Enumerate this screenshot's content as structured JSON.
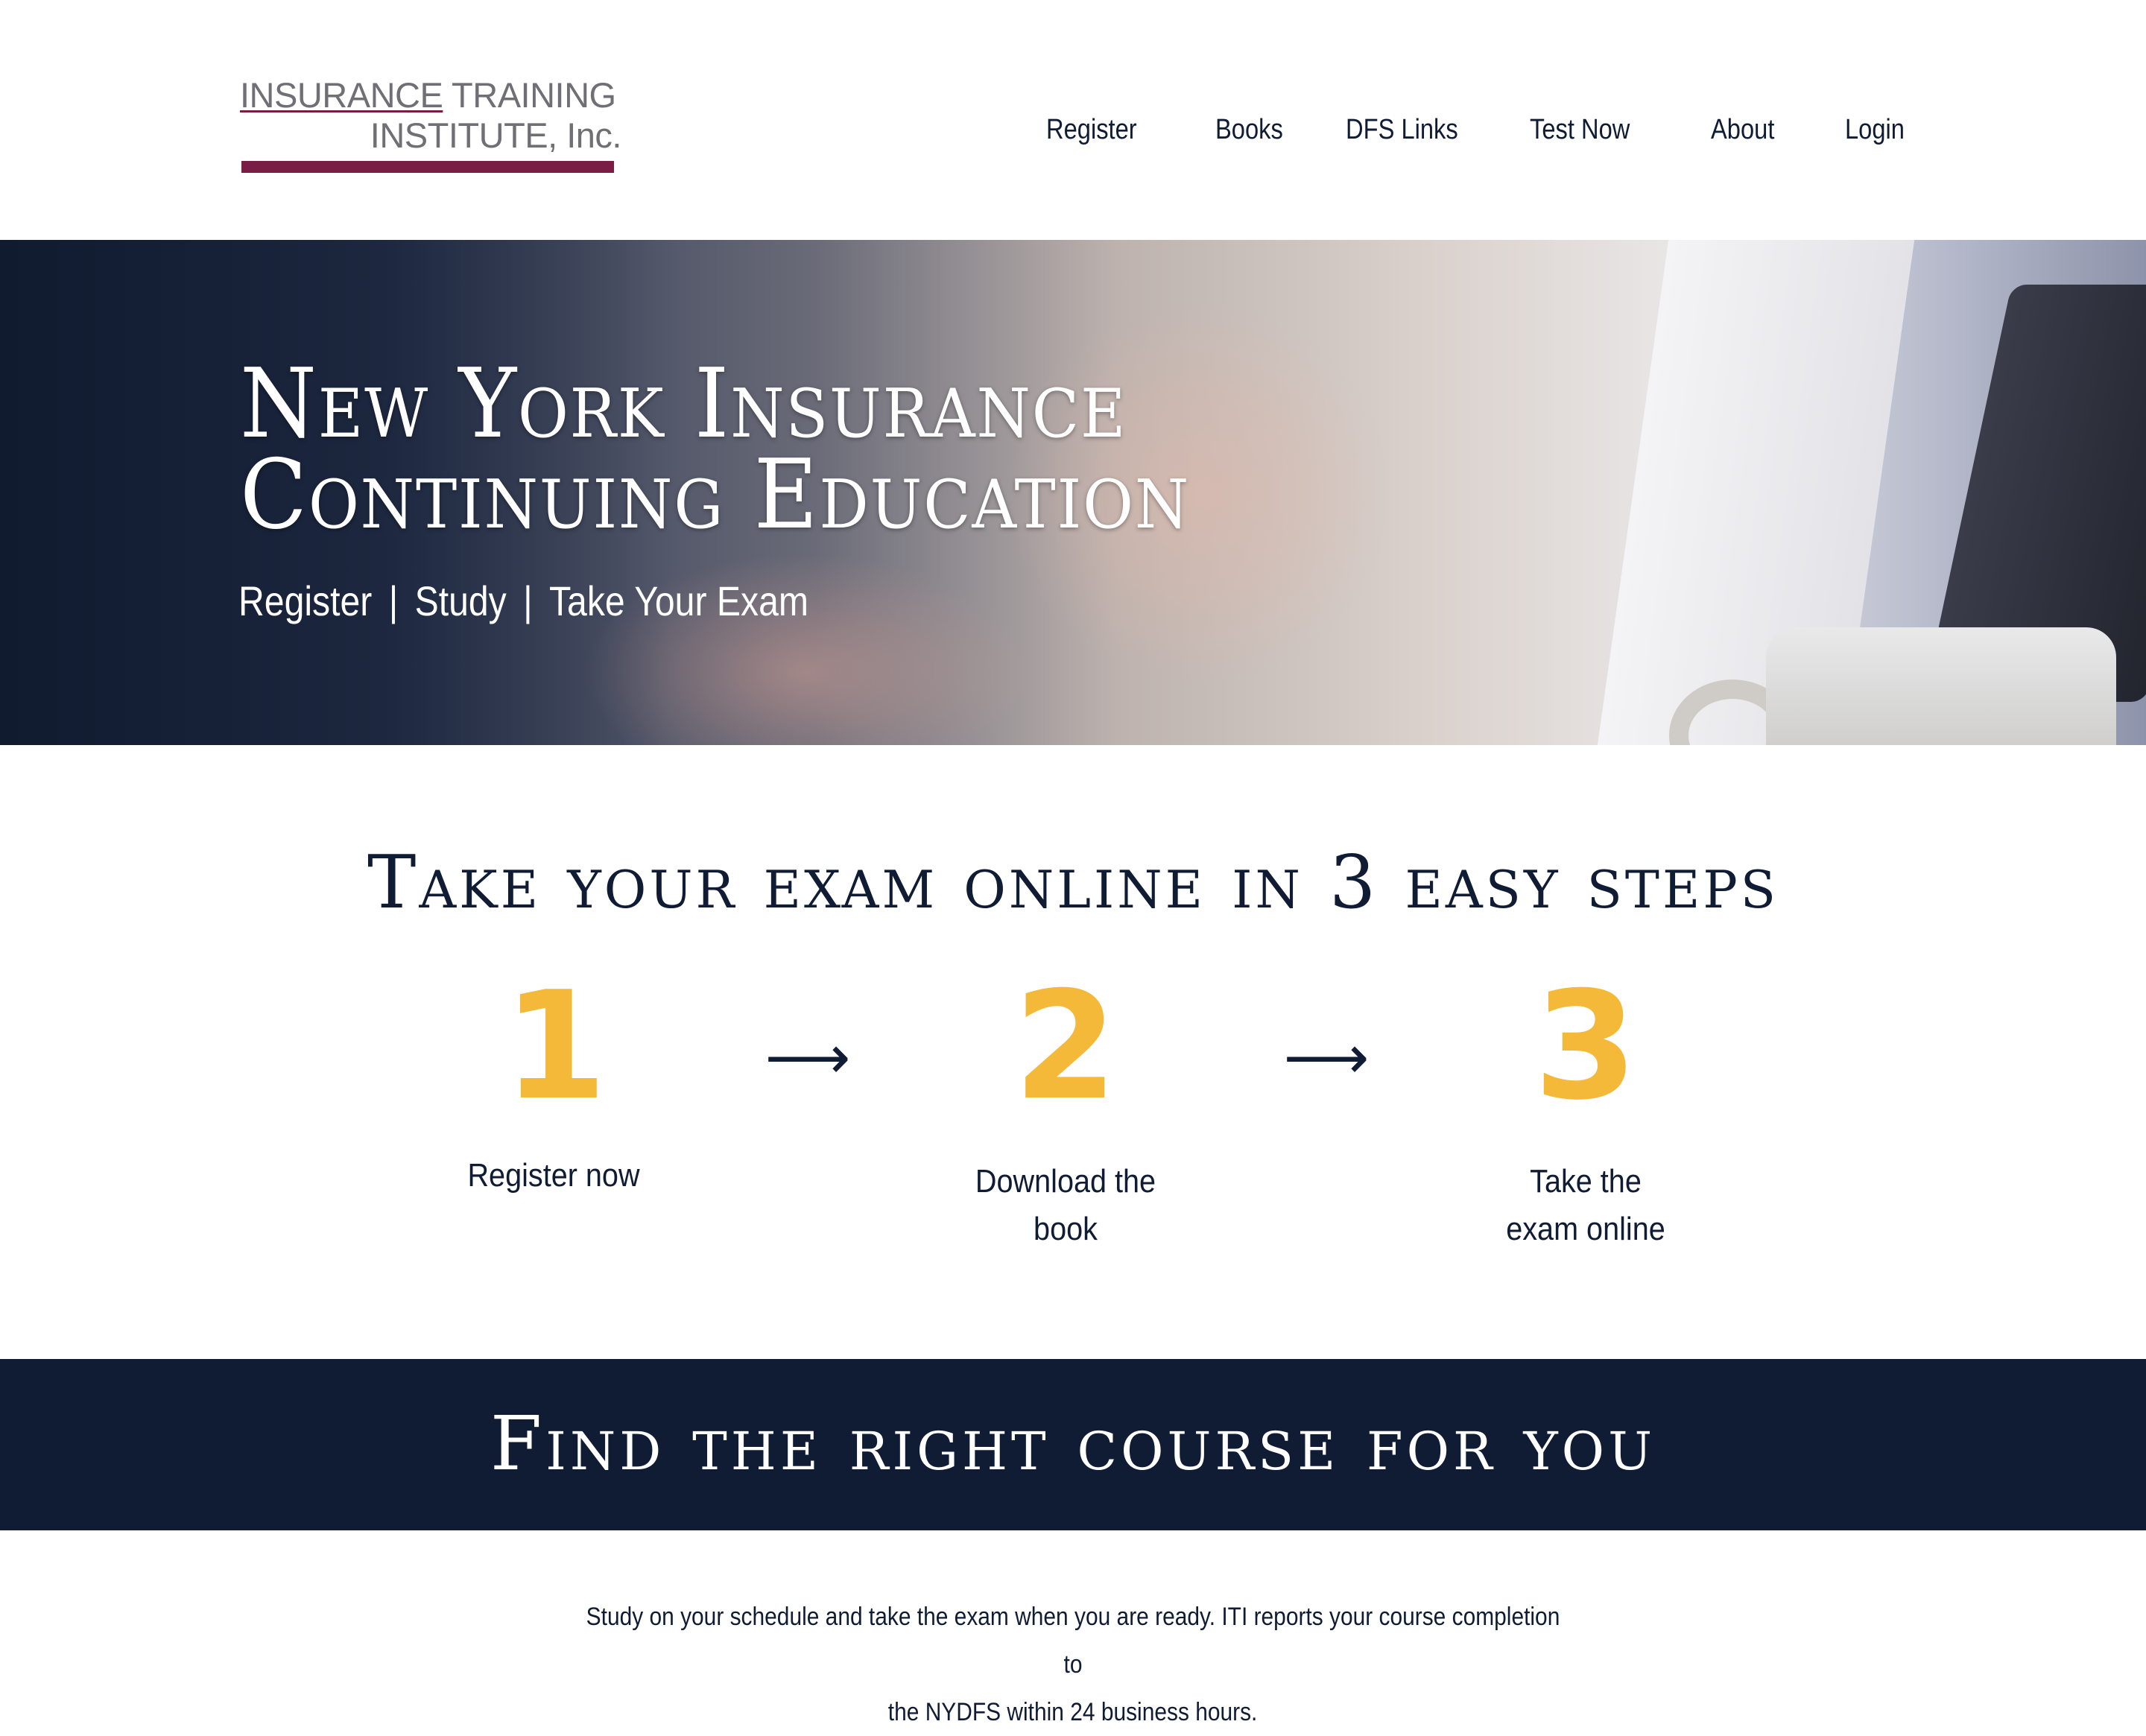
{
  "logo": {
    "line1_underlined": "INSURANCE",
    "line1_rest": " TRAINING",
    "line2": "INSTITUTE, Inc."
  },
  "nav": [
    {
      "label": "Register"
    },
    {
      "label": "Books"
    },
    {
      "label": "DFS Links"
    },
    {
      "label": "Test Now"
    },
    {
      "label": "About"
    },
    {
      "label": "Login"
    }
  ],
  "hero": {
    "title_line1": "New York Insurance",
    "title_line2": "Continuing Education",
    "sub_links": [
      "Register",
      "Study",
      "Take Your Exam"
    ],
    "separator": "|"
  },
  "steps": {
    "title": "Take your exam online in 3 easy steps",
    "arrow": "⟶",
    "items": [
      {
        "number": "1",
        "label": "Register now"
      },
      {
        "number": "2",
        "label": "Download the book"
      },
      {
        "number": "3",
        "label": "Take the exam online"
      }
    ]
  },
  "banner": {
    "title": "Find the right course for you"
  },
  "info": {
    "line1": "Study on your schedule and take the exam when you are ready. ITI reports your course completion to",
    "line2": "the NYDFS within 24 business hours."
  },
  "colors": {
    "brand_maroon": "#7a1d45",
    "navy": "#0f1c33",
    "accent_yellow": "#f5b93a"
  }
}
